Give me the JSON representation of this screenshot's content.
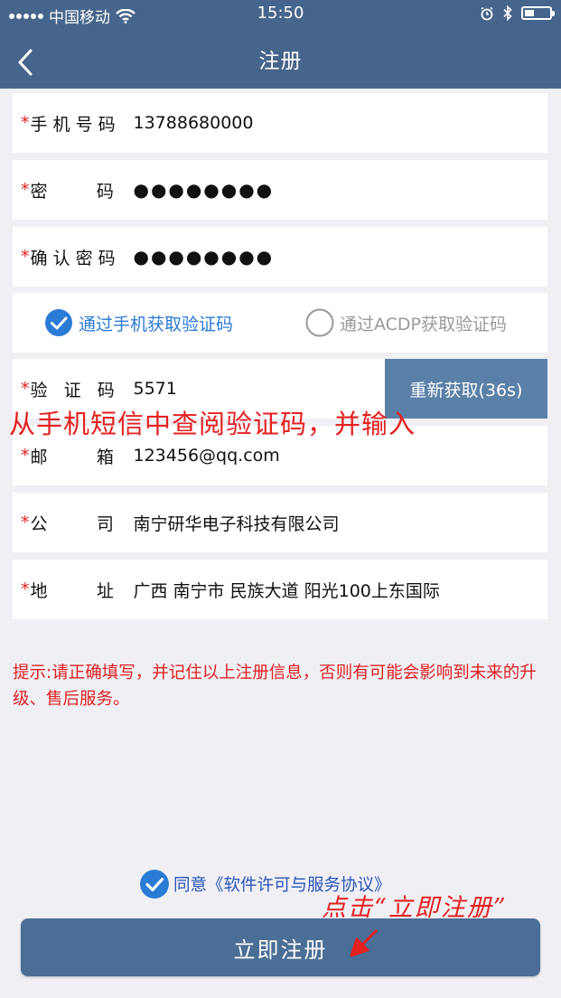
{
  "status_bar": {
    "carrier": "中国移动",
    "time": "15:50"
  },
  "nav": {
    "title": "注册"
  },
  "form": {
    "phone": {
      "required_mark": "*",
      "label": "手 机 号 码",
      "value": "13788680000"
    },
    "password": {
      "required_mark": "*",
      "label": "密         码",
      "value": "●●●●●●●●"
    },
    "confirm_password": {
      "required_mark": "*",
      "label": "确 认 密 码",
      "value": "●●●●●●●●"
    },
    "verify_method": {
      "option_phone": "通过手机获取验证码",
      "option_acdp": "通过ACDP获取验证码",
      "selected": "option_phone"
    },
    "code": {
      "required_mark": "*",
      "label": "验   证   码",
      "value": "5571",
      "resend_label": "重新获取(36s)"
    },
    "email": {
      "required_mark": "*",
      "label": "邮         箱",
      "value": "123456@qq.com"
    },
    "company": {
      "required_mark": "*",
      "label": "公         司",
      "value": "南宁研华电子科技有限公司"
    },
    "address": {
      "required_mark": "*",
      "label": "地         址",
      "value": "广西 南宁市 民族大道 阳光100上东国际"
    }
  },
  "tip": "提示:请正确填写，并记住以上注册信息，否则有可能会影响到未来的升级、售后服务。",
  "agreement": {
    "text": "同意《软件许可与服务协议》",
    "checked": true
  },
  "submit_label": "立即注册",
  "annotations": {
    "verify_hint": "从手机短信中查阅验证码，并输入",
    "submit_hint": "点击“立即注册”"
  },
  "colors": {
    "header": "#46658c",
    "accent_blue": "#2a7bd6",
    "annotation_red": "#e52020",
    "button": "#4a6e96"
  }
}
